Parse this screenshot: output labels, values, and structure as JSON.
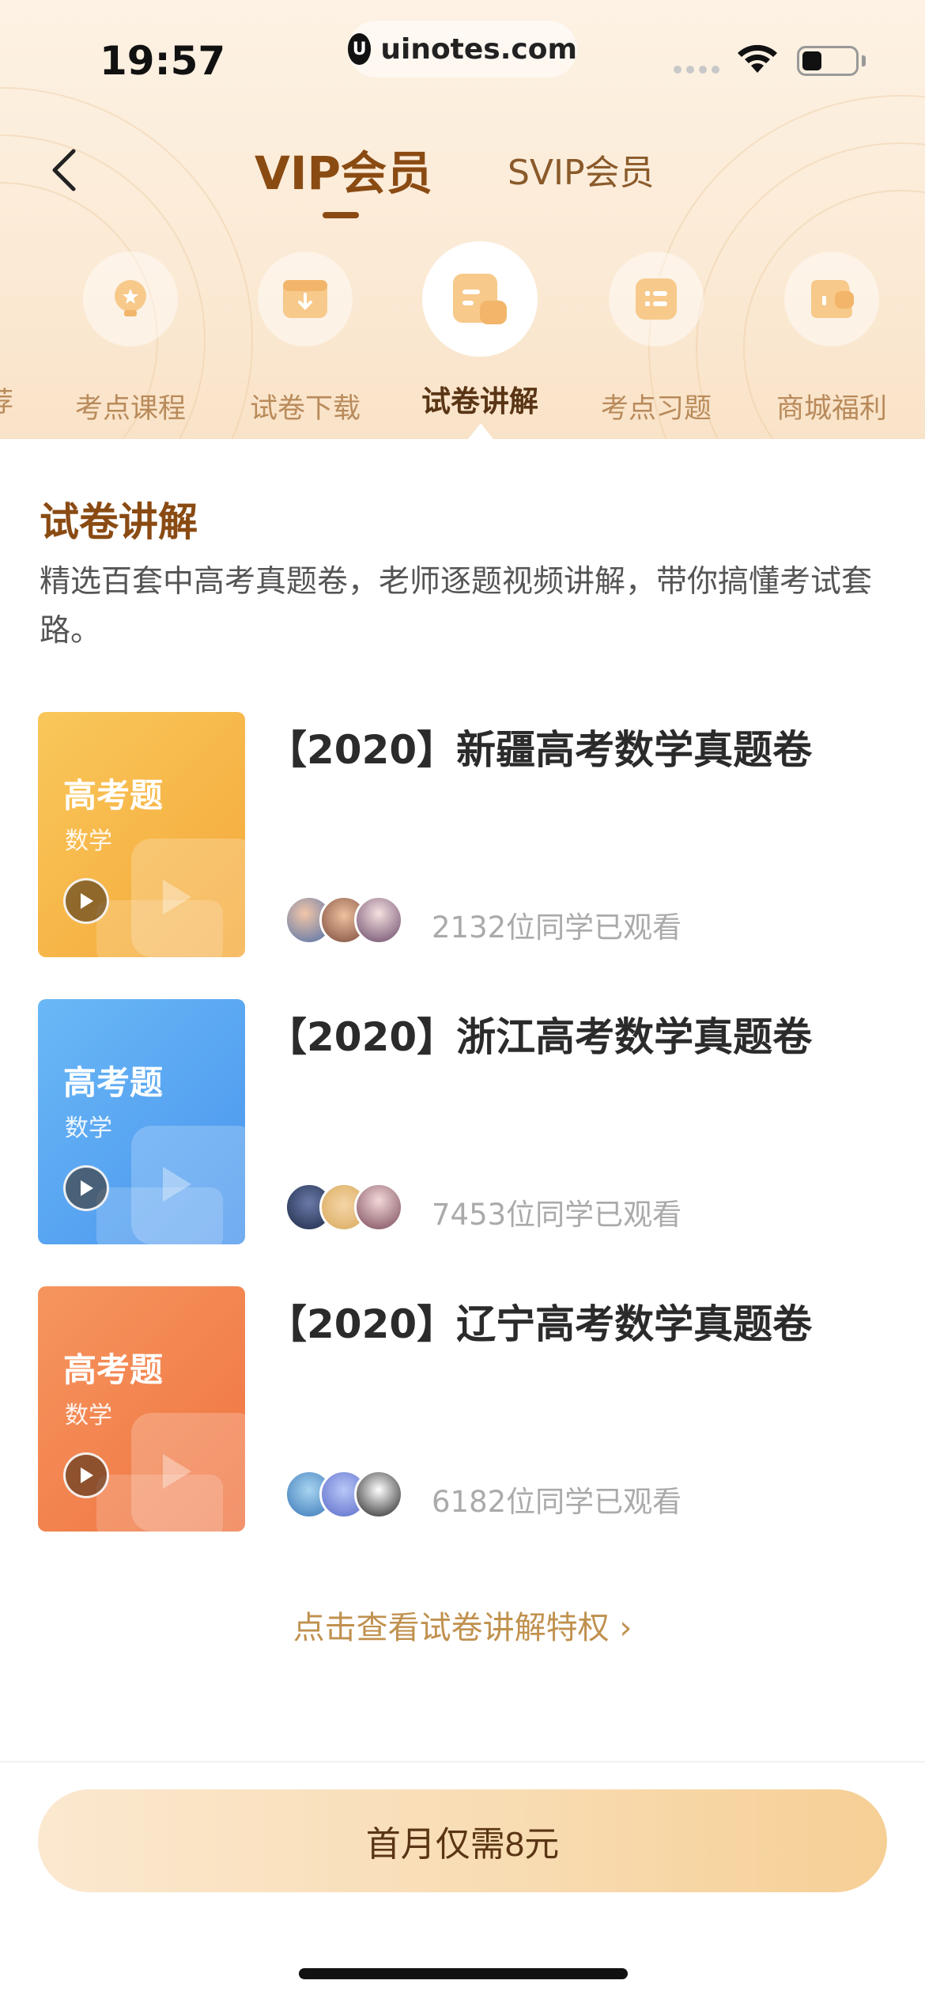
{
  "status_bar": {
    "time": "19:57",
    "url_logo": "U",
    "url": "uinotes.com"
  },
  "nav": {
    "back_icon": "chevron-left-icon",
    "tabs": [
      {
        "label": "VIP会员",
        "active": true
      },
      {
        "label": "SVIP会员",
        "active": false
      }
    ]
  },
  "categories": {
    "partial_left": "荐",
    "items": [
      {
        "label": "考点课程",
        "icon": "bulb-icon",
        "active": false
      },
      {
        "label": "试卷下载",
        "icon": "download-box-icon",
        "active": false
      },
      {
        "label": "试卷讲解",
        "icon": "paper-explain-icon",
        "active": true
      },
      {
        "label": "考点习题",
        "icon": "exercise-list-icon",
        "active": false
      },
      {
        "label": "商城福利",
        "icon": "wallet-icon",
        "active": false
      }
    ]
  },
  "section": {
    "title": "试卷讲解",
    "description": "精选百套中高考真题卷，老师逐题视频讲解，带你搞懂考试套路。"
  },
  "papers": [
    {
      "thumb_title": "高考题",
      "thumb_subject": "数学",
      "title": "【2020】新疆高考数学真题卷",
      "viewers": "2132位同学已观看",
      "color": "#f7b84a"
    },
    {
      "thumb_title": "高考题",
      "thumb_subject": "数学",
      "title": "【2020】浙江高考数学真题卷",
      "viewers": "7453位同学已观看",
      "color": "#5aa9f2"
    },
    {
      "thumb_title": "高考题",
      "thumb_subject": "数学",
      "title": "【2020】辽宁高考数学真题卷",
      "viewers": "6182位同学已观看",
      "color": "#f28a55"
    }
  ],
  "privilege_link": "点击查看试卷讲解特权 ›",
  "cta": "首月仅需8元",
  "colors": {
    "brand_brown": "#8a4b13",
    "accent_gold": "#c0914f"
  }
}
